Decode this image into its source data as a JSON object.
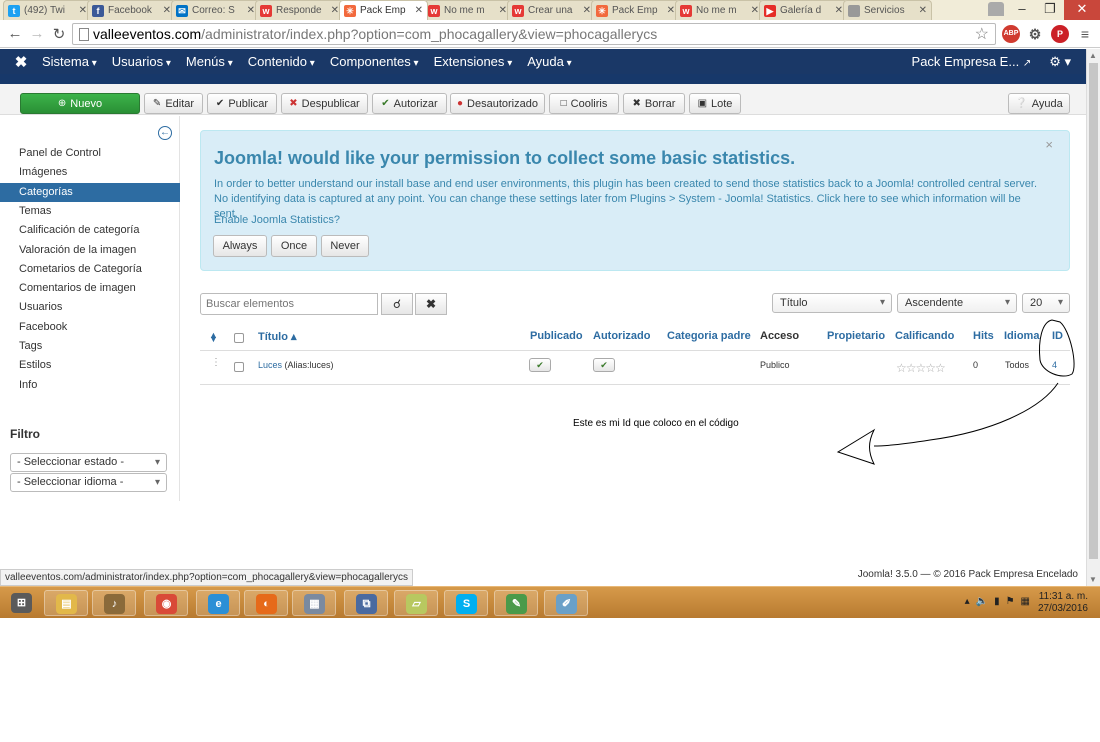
{
  "browser": {
    "tabs": [
      {
        "label": "(492) Twi",
        "color": "#1da1f2",
        "glyph": "t",
        "active": false
      },
      {
        "label": "Facebook",
        "color": "#3b5998",
        "glyph": "f",
        "active": false
      },
      {
        "label": "Correo: S",
        "color": "#0072c6",
        "glyph": "✉",
        "active": false
      },
      {
        "label": "Responde",
        "color": "#e53935",
        "glyph": "w",
        "active": false
      },
      {
        "label": "Pack Emp",
        "color": "#f2693d",
        "glyph": "✳",
        "active": true
      },
      {
        "label": "No me m",
        "color": "#e53935",
        "glyph": "w",
        "active": false
      },
      {
        "label": "Crear una",
        "color": "#e53935",
        "glyph": "w",
        "active": false
      },
      {
        "label": "Pack Emp",
        "color": "#f2693d",
        "glyph": "✳",
        "active": false
      },
      {
        "label": "No me m",
        "color": "#e53935",
        "glyph": "w",
        "active": false
      },
      {
        "label": "Galería d",
        "color": "#e52d27",
        "glyph": "▶",
        "active": false
      },
      {
        "label": "Servicios",
        "color": "#999999",
        "glyph": "",
        "active": false
      }
    ],
    "url_host": "valleeventos.com",
    "url_path": "/administrator/index.php?option=com_phocagallery&view=phocagallerycs",
    "abp_label": "ABP"
  },
  "joomla_nav": {
    "items": [
      "Sistema",
      "Usuarios",
      "Menús",
      "Contenido",
      "Componentes",
      "Extensiones",
      "Ayuda"
    ],
    "site_label": "Pack Empresa E..."
  },
  "toolbar": {
    "new": "Nuevo",
    "edit": "Editar",
    "publish": "Publicar",
    "unpublish": "Despublicar",
    "authorize": "Autorizar",
    "unauthorize": "Desautorizado",
    "cooliris": "Cooliris",
    "delete": "Borrar",
    "batch": "Lote",
    "help": "Ayuda"
  },
  "sidebar": {
    "items": [
      "Panel de Control",
      "Imágenes",
      "Categorías",
      "Temas",
      "Calificación de categoría",
      "Valoración de la imagen",
      "Cometarios de Categoría",
      "Comentarios de imagen",
      "Usuarios",
      "Facebook",
      "Tags",
      "Estilos",
      "Info"
    ],
    "active_index": 2,
    "filter_title": "Filtro",
    "filter_state": "- Seleccionar estado -",
    "filter_language": "- Seleccionar idioma -"
  },
  "stats": {
    "title": "Joomla! would like your permission to collect some basic statistics.",
    "body": "In order to better understand our install base and end user environments, this plugin has been created to send those statistics back to a Joomla! controlled central server. No identifying data is captured at any point. You can change these settings later from Plugins > System - Joomla! Statistics. Click here to see which information will be sent.",
    "enable": "Enable Joomla Statistics?",
    "always": "Always",
    "once": "Once",
    "never": "Never",
    "close": "×"
  },
  "search": {
    "placeholder": "Buscar elementos",
    "sort_field": "Título",
    "sort_dir": "Ascendente",
    "limit": "20"
  },
  "table": {
    "columns": [
      "Título ▴",
      "Publicado",
      "Autorizado",
      "Categoria padre",
      "Acceso",
      "Propietario",
      "Calificando",
      "Hits",
      "Idioma",
      "ID"
    ],
    "rows": [
      {
        "title": "Luces",
        "alias": "(Alias:luces)",
        "access": "Publico",
        "hits": "0",
        "language": "Todos",
        "id": "4"
      }
    ]
  },
  "annotation": {
    "text": "Este es mi Id que coloco en el código"
  },
  "status_url": "valleeventos.com/administrator/index.php?option=com_phocagallery&view=phocagallerycs",
  "footer": "Joomla! 3.5.0 — © 2016 Pack Empresa Encelado",
  "taskbar": {
    "apps": [
      {
        "name": "start-button",
        "color": "#5a5a5a",
        "glyph": "⊞"
      },
      {
        "name": "explorer-icon",
        "color": "#e2b84a",
        "glyph": "▤"
      },
      {
        "name": "music-icon",
        "color": "#8a6a3a",
        "glyph": "♪"
      },
      {
        "name": "chrome-icon",
        "color": "#d94a38",
        "glyph": "◉"
      },
      {
        "name": "ie-icon",
        "color": "#2b8fd6",
        "glyph": "e"
      },
      {
        "name": "firefox-icon",
        "color": "#e66a1a",
        "glyph": "◐"
      },
      {
        "name": "calculator-icon",
        "color": "#7a8aa0",
        "glyph": "▦"
      },
      {
        "name": "network-icon",
        "color": "#4a6aa0",
        "glyph": "⧉"
      },
      {
        "name": "notes-icon",
        "color": "#b8c860",
        "glyph": "▱"
      },
      {
        "name": "skype-icon",
        "color": "#00aff0",
        "glyph": "S"
      },
      {
        "name": "photos-icon",
        "color": "#4a9a4a",
        "glyph": "✎"
      },
      {
        "name": "paint-icon",
        "color": "#6aa0c8",
        "glyph": "✐"
      }
    ],
    "time": "11:31 a. m.",
    "date": "27/03/2016"
  }
}
